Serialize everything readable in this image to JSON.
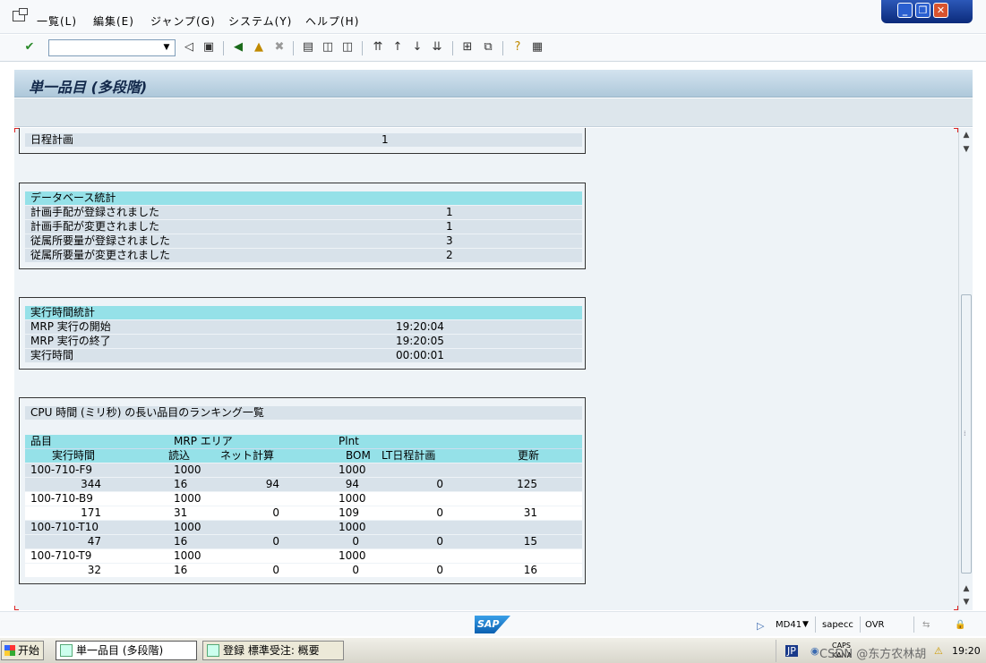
{
  "menu": {
    "items": [
      "一覧(L)",
      "編集(E)",
      "ジャンプ(G)",
      "システム(Y)",
      "ヘルプ(H)"
    ]
  },
  "toolbar": {
    "icons": [
      "enter-icon",
      "back-icon",
      "exit-icon",
      "cancel-icon",
      "save-icon",
      "print-icon",
      "find-icon",
      "find-next-icon",
      "first-page-icon",
      "prev-page-icon",
      "next-page-icon",
      "last-page-icon",
      "new-session-icon",
      "shortcut-icon",
      "help-icon",
      "layout-icon"
    ]
  },
  "title": "単一品目 (多段階)",
  "schedule": {
    "label": "日程計画",
    "value": "1"
  },
  "db_stats": {
    "header": "データベース統計",
    "rows": [
      {
        "label": "計画手配が登録されました",
        "value": "1"
      },
      {
        "label": "計画手配が変更されました",
        "value": "1"
      },
      {
        "label": "従属所要量が登録されました",
        "value": "3"
      },
      {
        "label": "従属所要量が変更されました",
        "value": "2"
      }
    ]
  },
  "runtime_stats": {
    "header": "実行時間統計",
    "rows": [
      {
        "label": "MRP 実行の開始",
        "value": "19:20:04"
      },
      {
        "label": "MRP 実行の終了",
        "value": "19:20:05"
      },
      {
        "label": "実行時間",
        "value": "00:00:01"
      }
    ]
  },
  "ranking": {
    "header": "CPU 時間 (ミリ秒) の長い品目のランキング一覧",
    "col_header1": {
      "material": "品目",
      "mrp_area": "MRP エリア",
      "plant": "Plnt"
    },
    "col_header2": {
      "runtime": "実行時間",
      "read": "読込",
      "net_calc": "ネット計算",
      "bom": "BOM",
      "lt_schedule": "LT日程計画",
      "update": "更新"
    },
    "items": [
      {
        "material": "100-710-F9",
        "area": "1000",
        "plant": "1000",
        "runtime": "344",
        "read": "16",
        "net": "94",
        "bom": "94",
        "lt": "0",
        "update": "125"
      },
      {
        "material": "100-710-B9",
        "area": "1000",
        "plant": "1000",
        "runtime": "171",
        "read": "31",
        "net": "0",
        "bom": "109",
        "lt": "0",
        "update": "31"
      },
      {
        "material": "100-710-T10",
        "area": "1000",
        "plant": "1000",
        "runtime": "47",
        "read": "16",
        "net": "0",
        "bom": "0",
        "lt": "0",
        "update": "15"
      },
      {
        "material": "100-710-T9",
        "area": "1000",
        "plant": "1000",
        "runtime": "32",
        "read": "16",
        "net": "0",
        "bom": "0",
        "lt": "0",
        "update": "16"
      }
    ]
  },
  "status": {
    "transaction": "MD41",
    "server": "sapecc",
    "mode": "OVR",
    "logo": "SAP"
  },
  "taskbar": {
    "start": "开始",
    "tasks": [
      "単一品目 (多段階)",
      "登録 標準受注: 概要"
    ],
    "lang": "JP",
    "caps": "CAPS",
    "kana": "KANA",
    "time": "19:20",
    "watermark": "CSDN @东方农林胡"
  }
}
